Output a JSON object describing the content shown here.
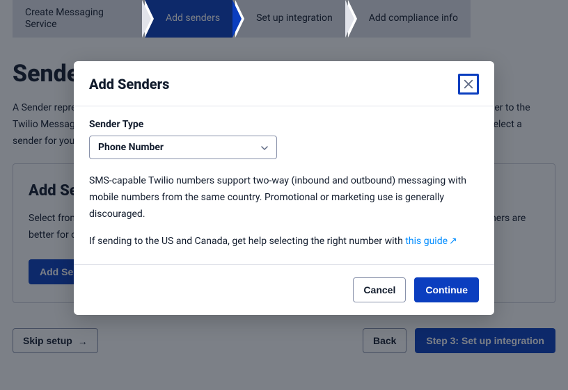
{
  "stepper": {
    "steps": [
      {
        "label": "Create Messaging Service"
      },
      {
        "label": "Add senders"
      },
      {
        "label": "Set up integration"
      },
      {
        "label": "Add compliance info"
      }
    ]
  },
  "page": {
    "title": "Sender Pool",
    "paragraph": "A Sender represents a specific channel, identity, number, or address you send messages from. By adding a Sender to the Twilio Messaging Service, the Messaging Service becomes capable of using that Sender to deliver messages. Select a sender for your use case.",
    "card_title": "Add Senders",
    "card_paragraph": "Select from different types of senders. Each sender works differently. Some Senders are faster to set up. Others are better for one approach.",
    "card_button": "Add Senders"
  },
  "footer": {
    "skip": "Skip setup",
    "back": "Back",
    "next": "Step 3: Set up integration"
  },
  "modal": {
    "title": "Add Senders",
    "field_label": "Sender Type",
    "selected": "Phone Number",
    "para1": "SMS-capable Twilio numbers support two-way (inbound and outbound) messaging with mobile numbers from the same country. Promotional or marketing use is generally discouraged.",
    "para2_prefix": "If sending to the US and Canada, get help selecting the right number with ",
    "para2_link": "this guide",
    "cancel": "Cancel",
    "continue": "Continue"
  }
}
